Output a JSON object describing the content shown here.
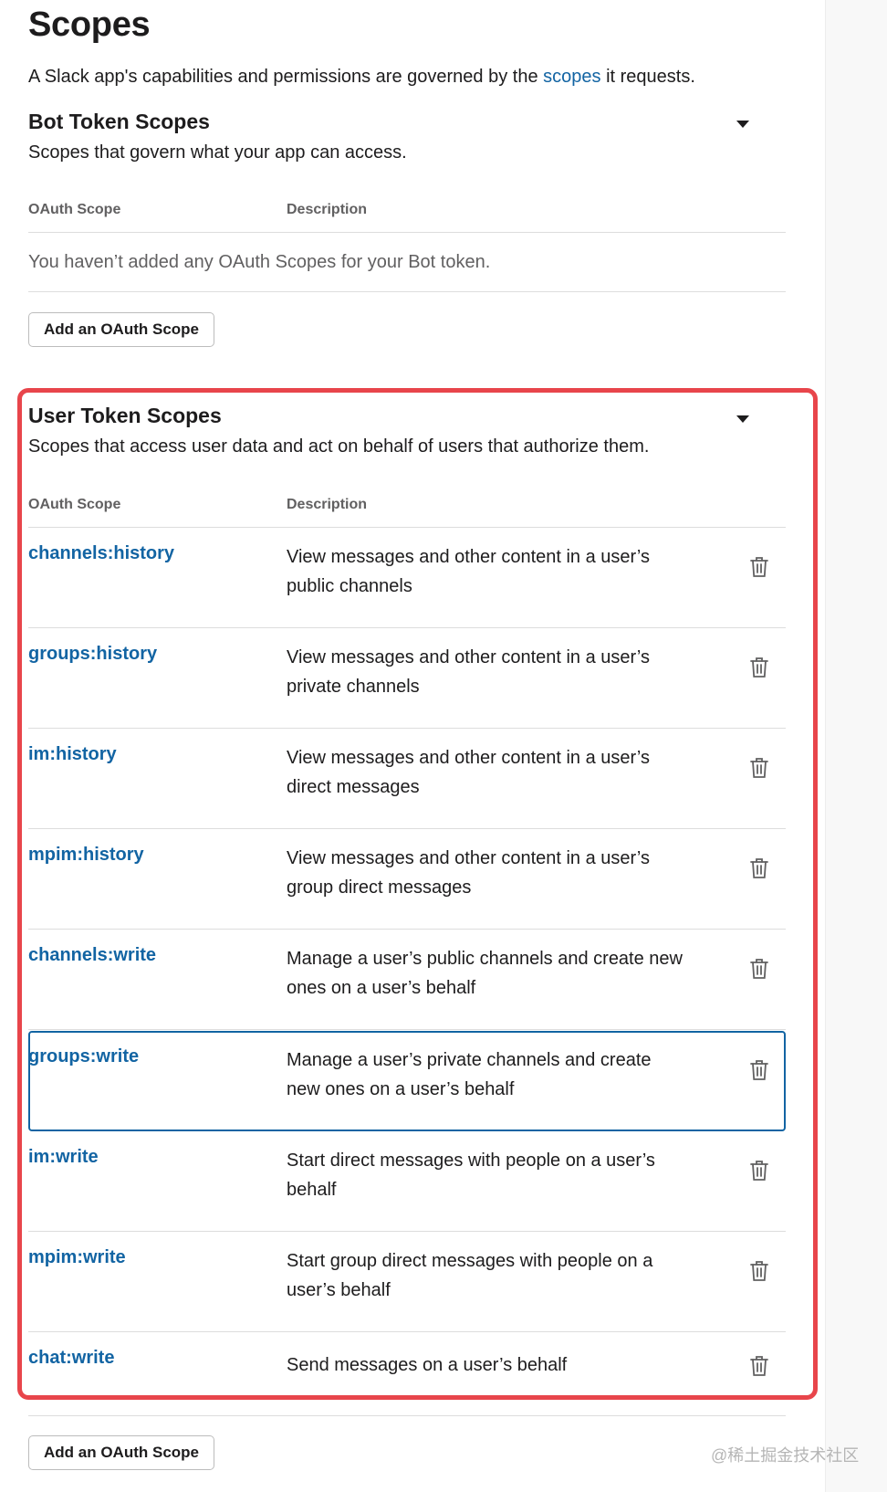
{
  "page": {
    "title": "Scopes",
    "intro_before": "A Slack app's capabilities and permissions are governed by the ",
    "intro_link": "scopes",
    "intro_after": " it requests."
  },
  "bot_section": {
    "title": "Bot Token Scopes",
    "subtitle": "Scopes that govern what your app can access.",
    "col_scope": "OAuth Scope",
    "col_description": "Description",
    "empty_message": "You haven’t added any OAuth Scopes for your Bot token.",
    "add_button": "Add an OAuth Scope"
  },
  "user_section": {
    "title": "User Token Scopes",
    "subtitle": "Scopes that access user data and act on behalf of users that authorize them.",
    "col_scope": "OAuth Scope",
    "col_description": "Description",
    "add_button": "Add an OAuth Scope",
    "scopes": [
      {
        "name": "channels:history",
        "description": "View messages and other content in a user’s public channels"
      },
      {
        "name": "groups:history",
        "description": "View messages and other content in a user’s private channels"
      },
      {
        "name": "im:history",
        "description": "View messages and other content in a user’s direct messages"
      },
      {
        "name": "mpim:history",
        "description": "View messages and other content in a user’s group direct messages"
      },
      {
        "name": "channels:write",
        "description": "Manage a user’s public channels and create new ones on a user’s behalf"
      },
      {
        "name": "groups:write",
        "description": "Manage a user’s private channels and create new ones on a user’s behalf"
      },
      {
        "name": "im:write",
        "description": "Start direct messages with people on a user’s behalf"
      },
      {
        "name": "mpim:write",
        "description": "Start group direct messages with people on a user’s behalf"
      },
      {
        "name": "chat:write",
        "description": "Send messages on a user’s behalf"
      }
    ]
  },
  "icons": {
    "collapse": "caret-down-icon",
    "remove": "trash-icon"
  },
  "colors": {
    "link": "#1264a3",
    "highlight": "#e8454b",
    "focus": "#1264a3"
  },
  "watermark": "@稀土掘金技术社区"
}
